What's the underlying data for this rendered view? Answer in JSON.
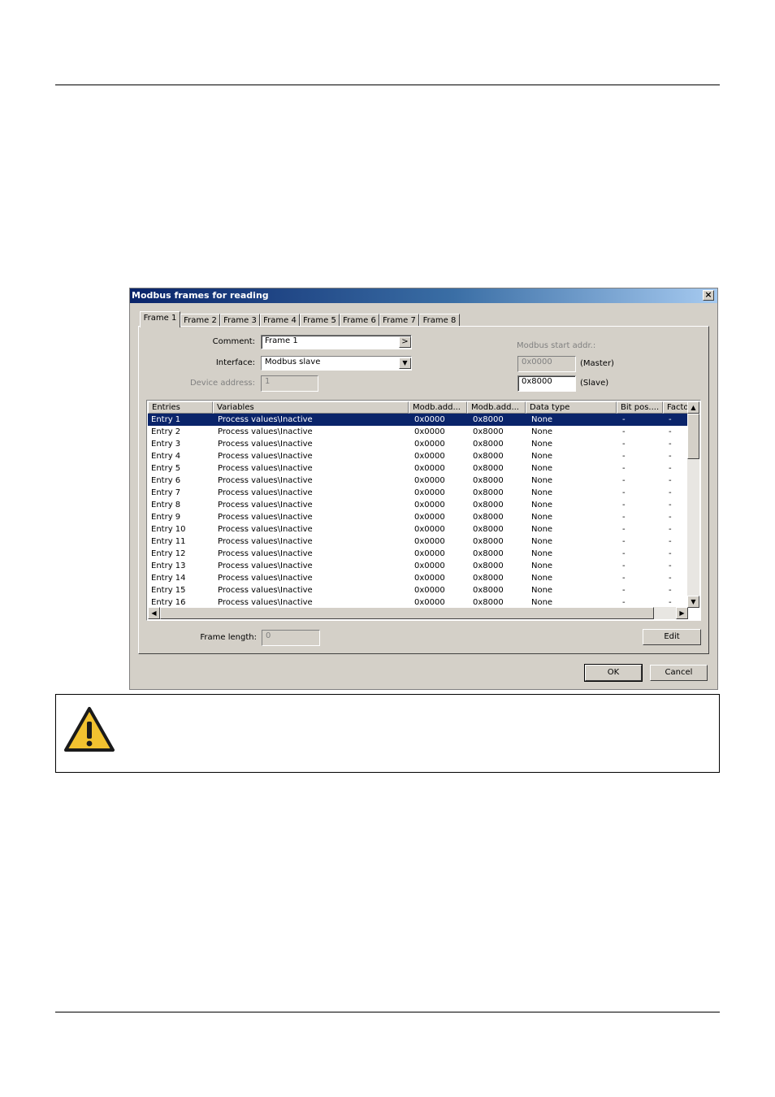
{
  "dialog": {
    "title": "Modbus frames for reading",
    "close": "×",
    "tabs": [
      "Frame 1",
      "Frame 2",
      "Frame 3",
      "Frame 4",
      "Frame 5",
      "Frame 6",
      "Frame 7",
      "Frame 8"
    ],
    "comment_label": "Comment:",
    "comment_value": "Frame 1",
    "comment_btn": ">",
    "interface_label": "Interface:",
    "interface_value": "Modbus slave",
    "device_address_label": "Device address:",
    "device_address_value": "1",
    "modbus_start_label": "Modbus start addr.:",
    "master_value": "0x0000",
    "master_label": "(Master)",
    "slave_value": "0x8000",
    "slave_label": "(Slave)",
    "columns": [
      "Entries",
      "Variables",
      "Modb.add...",
      "Modb.add...",
      "Data type",
      "Bit pos....",
      "Facto"
    ],
    "rows": [
      [
        "Entry 1",
        "Process values\\Inactive",
        "0x0000",
        "0x8000",
        "None",
        "-",
        "-"
      ],
      [
        "Entry 2",
        "Process values\\Inactive",
        "0x0000",
        "0x8000",
        "None",
        "-",
        "-"
      ],
      [
        "Entry 3",
        "Process values\\Inactive",
        "0x0000",
        "0x8000",
        "None",
        "-",
        "-"
      ],
      [
        "Entry 4",
        "Process values\\Inactive",
        "0x0000",
        "0x8000",
        "None",
        "-",
        "-"
      ],
      [
        "Entry 5",
        "Process values\\Inactive",
        "0x0000",
        "0x8000",
        "None",
        "-",
        "-"
      ],
      [
        "Entry 6",
        "Process values\\Inactive",
        "0x0000",
        "0x8000",
        "None",
        "-",
        "-"
      ],
      [
        "Entry 7",
        "Process values\\Inactive",
        "0x0000",
        "0x8000",
        "None",
        "-",
        "-"
      ],
      [
        "Entry 8",
        "Process values\\Inactive",
        "0x0000",
        "0x8000",
        "None",
        "-",
        "-"
      ],
      [
        "Entry 9",
        "Process values\\Inactive",
        "0x0000",
        "0x8000",
        "None",
        "-",
        "-"
      ],
      [
        "Entry 10",
        "Process values\\Inactive",
        "0x0000",
        "0x8000",
        "None",
        "-",
        "-"
      ],
      [
        "Entry 11",
        "Process values\\Inactive",
        "0x0000",
        "0x8000",
        "None",
        "-",
        "-"
      ],
      [
        "Entry 12",
        "Process values\\Inactive",
        "0x0000",
        "0x8000",
        "None",
        "-",
        "-"
      ],
      [
        "Entry 13",
        "Process values\\Inactive",
        "0x0000",
        "0x8000",
        "None",
        "-",
        "-"
      ],
      [
        "Entry 14",
        "Process values\\Inactive",
        "0x0000",
        "0x8000",
        "None",
        "-",
        "-"
      ],
      [
        "Entry 15",
        "Process values\\Inactive",
        "0x0000",
        "0x8000",
        "None",
        "-",
        "-"
      ],
      [
        "Entry 16",
        "Process values\\Inactive",
        "0x0000",
        "0x8000",
        "None",
        "-",
        "-"
      ]
    ],
    "selected_row": 0,
    "frame_length_label": "Frame length:",
    "frame_length_value": "0",
    "edit_btn": "Edit",
    "ok_btn": "OK",
    "cancel_btn": "Cancel"
  },
  "warning": {
    "icon": "warning-triangle-icon"
  },
  "colors": {
    "titlebar": "#0a246a",
    "selection": "#0a246a",
    "face": "#d4d0c8",
    "warning_yellow": "#f2c230"
  }
}
